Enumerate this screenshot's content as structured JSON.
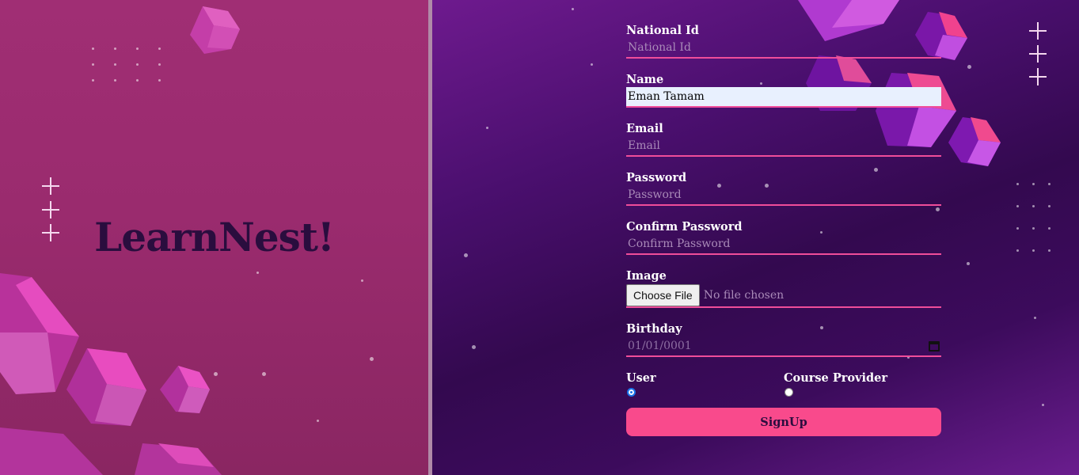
{
  "brand": {
    "title": "LearnNest!"
  },
  "form": {
    "national_id": {
      "label": "National Id",
      "placeholder": "National Id",
      "value": ""
    },
    "name": {
      "label": "Name",
      "placeholder": "Name",
      "value": "Eman Tamam"
    },
    "email": {
      "label": "Email",
      "placeholder": "Email",
      "value": ""
    },
    "password": {
      "label": "Password",
      "placeholder": "Password",
      "value": ""
    },
    "confirm_password": {
      "label": "Confirm Password",
      "placeholder": "Confirm Password",
      "value": ""
    },
    "image": {
      "label": "Image",
      "button_label": "Choose File",
      "status": "No file chosen"
    },
    "birthday": {
      "label": "Birthday",
      "value": "01/01/0001",
      "icon": "calendar-icon"
    },
    "roles": [
      {
        "label": "User",
        "checked": true
      },
      {
        "label": "Course Provider",
        "checked": false
      }
    ],
    "submit_label": "SignUp"
  },
  "colors": {
    "accent": "#f94a8c",
    "underline": "#f04d9a",
    "left_bg": "#9a2b6e",
    "right_bg": "#3c0b5c",
    "brand_text": "#2a0d3e"
  }
}
